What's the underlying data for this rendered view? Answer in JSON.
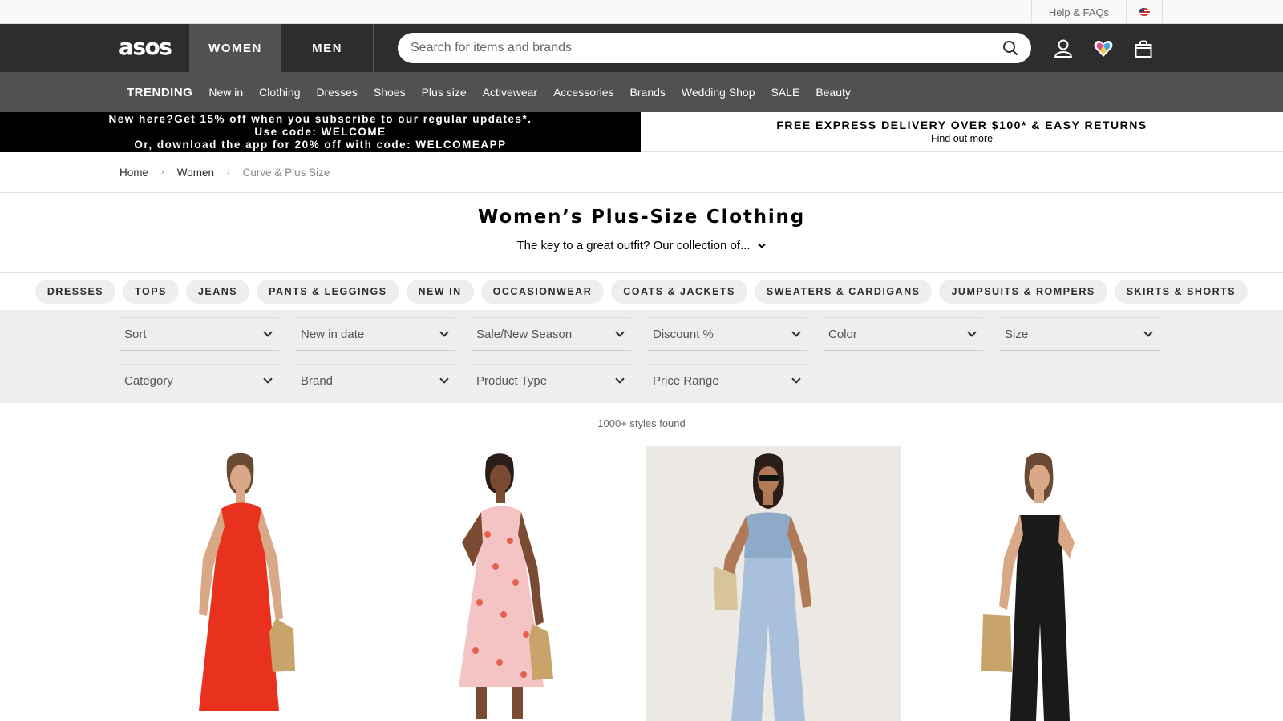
{
  "utility": {
    "help_label": "Help & FAQs",
    "country_flag_icon": "us-flag-icon"
  },
  "header": {
    "logo": "asos",
    "tabs": [
      {
        "label": "WOMEN",
        "active": true
      },
      {
        "label": "MEN",
        "active": false
      }
    ],
    "search_placeholder": "Search for items and brands",
    "icons": [
      "search-icon",
      "account-icon",
      "saved-items-icon",
      "bag-icon"
    ]
  },
  "nav": {
    "items": [
      "TRENDING",
      "New in",
      "Clothing",
      "Dresses",
      "Shoes",
      "Plus size",
      "Activewear",
      "Accessories",
      "Brands",
      "Wedding Shop",
      "SALE",
      "Beauty"
    ]
  },
  "promo": {
    "left_line1": "New here?Get 15% off when you subscribe to our regular updates*.",
    "left_line2": "Use code: WELCOME",
    "left_line3": "Or, download the app for 20% off with code: WELCOMEAPP",
    "right_title": "FREE EXPRESS DELIVERY OVER $100* & EASY RETURNS",
    "right_link": "Find out more"
  },
  "breadcrumb": {
    "items": [
      "Home",
      "Women",
      "Curve & Plus Size"
    ],
    "separator": "›"
  },
  "page": {
    "title": "Women’s Plus-Size Clothing",
    "description": "The key to a great outfit? Our collection of..."
  },
  "categories": [
    "DRESSES",
    "TOPS",
    "JEANS",
    "PANTS & LEGGINGS",
    "NEW IN",
    "OCCASIONWEAR",
    "COATS & JACKETS",
    "SWEATERS & CARDIGANS",
    "JUMPSUITS & ROMPERS",
    "SKIRTS & SHORTS"
  ],
  "filters": {
    "row1": [
      "Sort",
      "New in date",
      "Sale/New Season",
      "Discount %",
      "Color",
      "Size"
    ],
    "row2": [
      "Category",
      "Brand",
      "Product Type",
      "Price Range"
    ]
  },
  "results": {
    "count_label": "1000+ styles found"
  },
  "products": [
    {
      "image": "red-maxi-dress-model",
      "color": "#e8321e"
    },
    {
      "image": "pink-floral-midi-dress-model",
      "color": "#f4c4c4"
    },
    {
      "image": "blue-wide-leg-jumpsuit-model",
      "color": "#a8c0dc"
    },
    {
      "image": "black-jumpsuit-model",
      "color": "#1a1a1a"
    }
  ],
  "colors": {
    "header_bg": "#2d2d2d",
    "nav_bg": "#525050",
    "filter_bg": "#eeeeee"
  }
}
